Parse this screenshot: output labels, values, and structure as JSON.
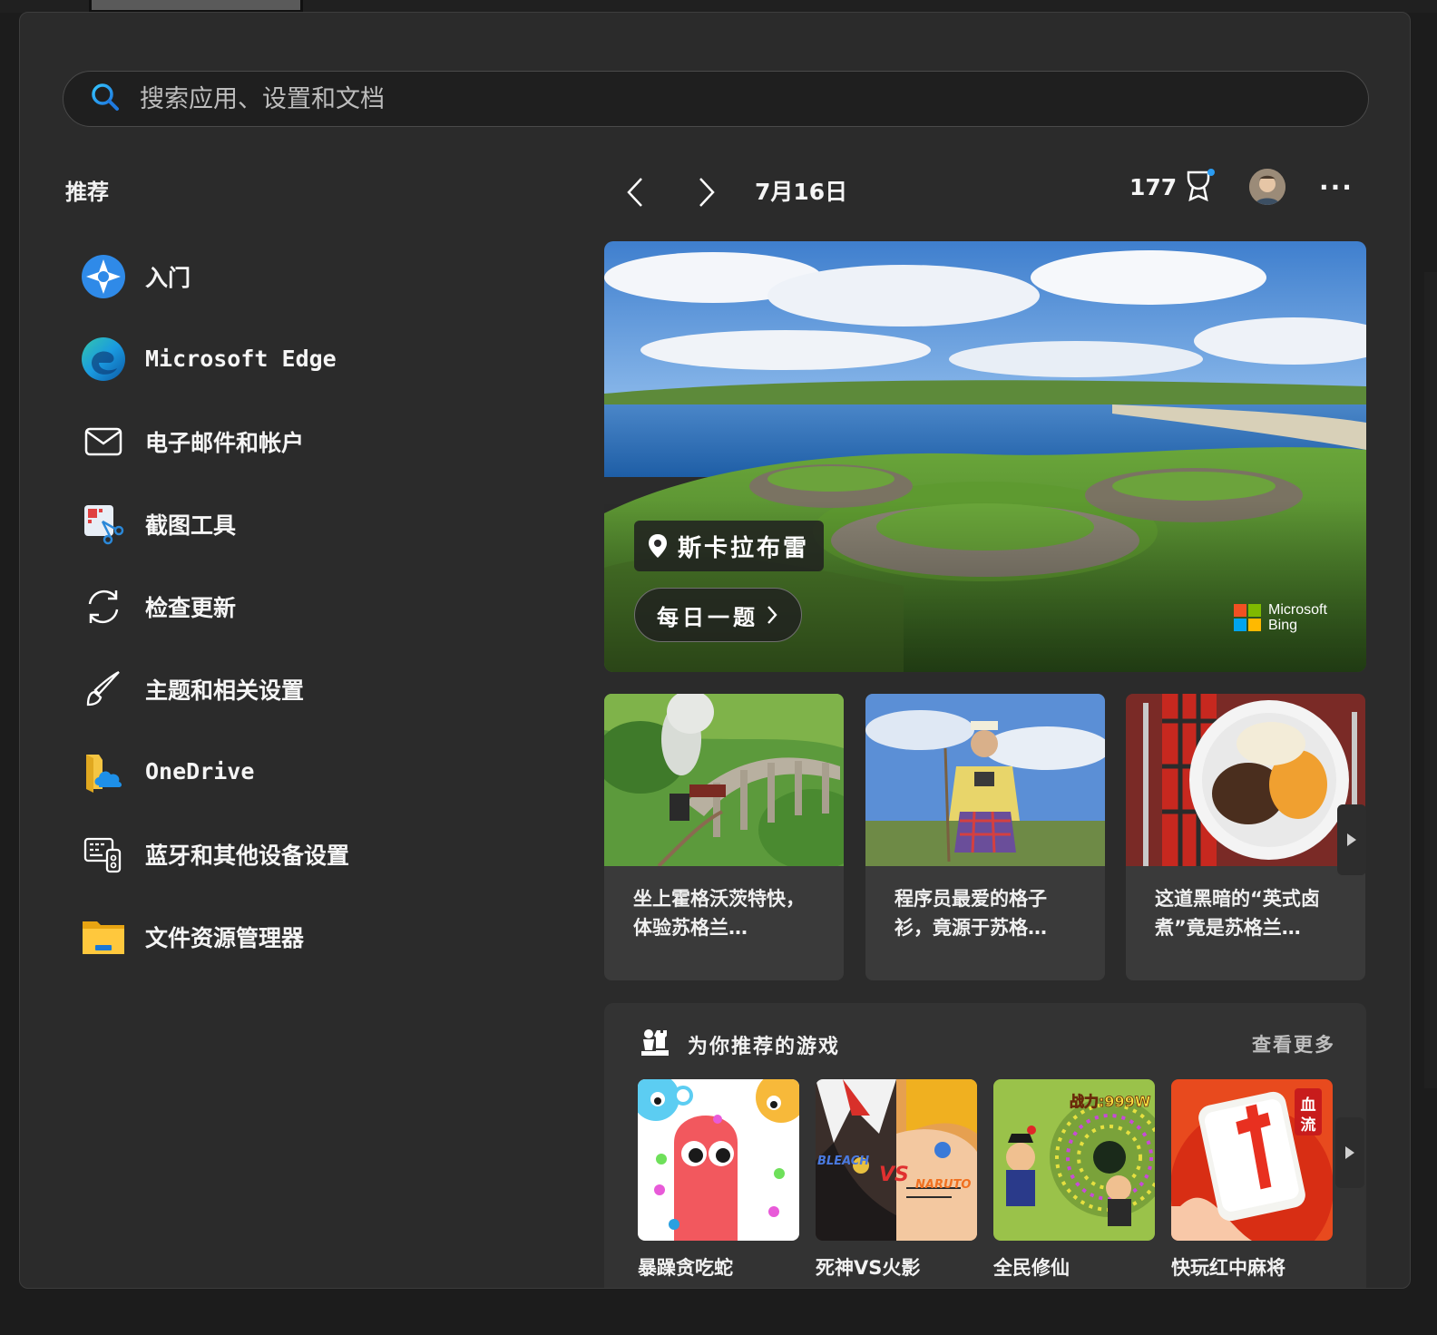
{
  "search": {
    "placeholder": "搜索应用、设置和文档"
  },
  "recommended": {
    "title": "推荐",
    "items": [
      {
        "label": "入门",
        "icon": "get-started-icon"
      },
      {
        "label": "Microsoft Edge",
        "icon": "edge-icon"
      },
      {
        "label": "电子邮件和帐户",
        "icon": "mail-icon"
      },
      {
        "label": "截图工具",
        "icon": "snipping-tool-icon"
      },
      {
        "label": "检查更新",
        "icon": "refresh-icon"
      },
      {
        "label": "主题和相关设置",
        "icon": "brush-icon"
      },
      {
        "label": "OneDrive",
        "icon": "onedrive-icon"
      },
      {
        "label": "蓝牙和其他设备设置",
        "icon": "devices-icon"
      },
      {
        "label": "文件资源管理器",
        "icon": "folder-icon"
      }
    ]
  },
  "header": {
    "date": "7月16日",
    "points": "177",
    "more": "···"
  },
  "hero": {
    "location": "斯卡拉布雷",
    "quiz_label": "每日一题",
    "brand_line1": "Microsoft",
    "brand_line2": "Bing"
  },
  "news": [
    {
      "caption": "坐上霍格沃茨特快，体验苏格兰…"
    },
    {
      "caption": "程序员最爱的格子衫，竟源于苏格…"
    },
    {
      "caption": "这道黑暗的“英式卤煮”竟是苏格兰…"
    }
  ],
  "games": {
    "title": "为你推荐的游戏",
    "more_label": "查看更多",
    "items": [
      {
        "name": "暴躁贪吃蛇"
      },
      {
        "name": "死神VS火影"
      },
      {
        "name": "全民修仙"
      },
      {
        "name": "快玩红中麻将"
      }
    ],
    "badge_text": "血流",
    "power_text": "战力:999W"
  },
  "colors": {
    "panel": "#2b2b2b",
    "card": "#3a3a3a",
    "accent": "#0078d4"
  }
}
